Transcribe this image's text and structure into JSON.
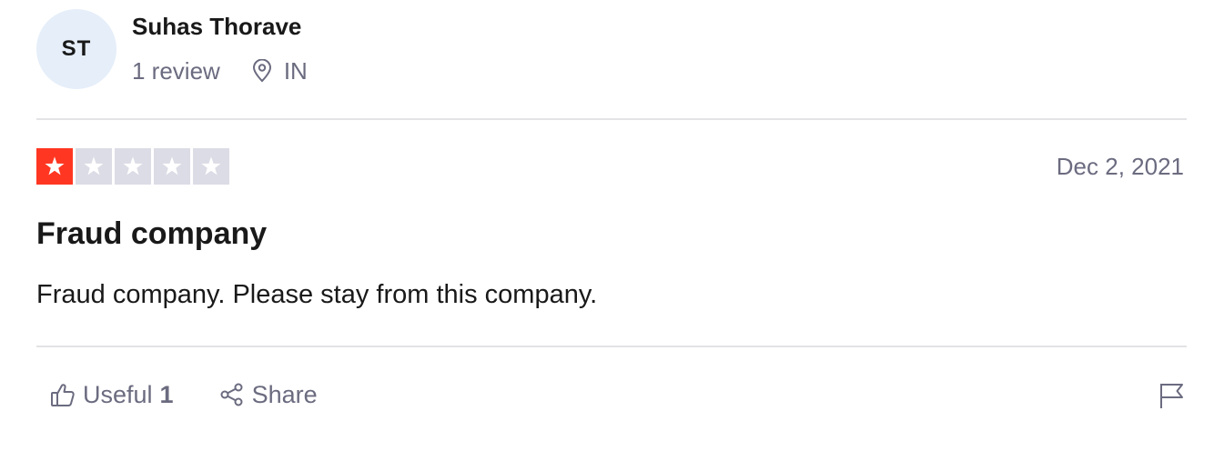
{
  "reviewer": {
    "initials": "ST",
    "name": "Suhas Thorave",
    "review_count": "1 review",
    "country": "IN"
  },
  "review": {
    "rating": 1,
    "max_rating": 5,
    "date": "Dec 2, 2021",
    "title": "Fraud company",
    "body": "Fraud company. Please stay from this company."
  },
  "actions": {
    "useful_label": "Useful",
    "useful_count": "1",
    "share_label": "Share"
  },
  "colors": {
    "star_filled": "#ff3722",
    "star_empty": "#dcdce6",
    "avatar_bg": "#e5eef9"
  },
  "icons": [
    "location-pin-icon",
    "star-icon",
    "thumbs-up-icon",
    "share-icon",
    "flag-icon"
  ]
}
